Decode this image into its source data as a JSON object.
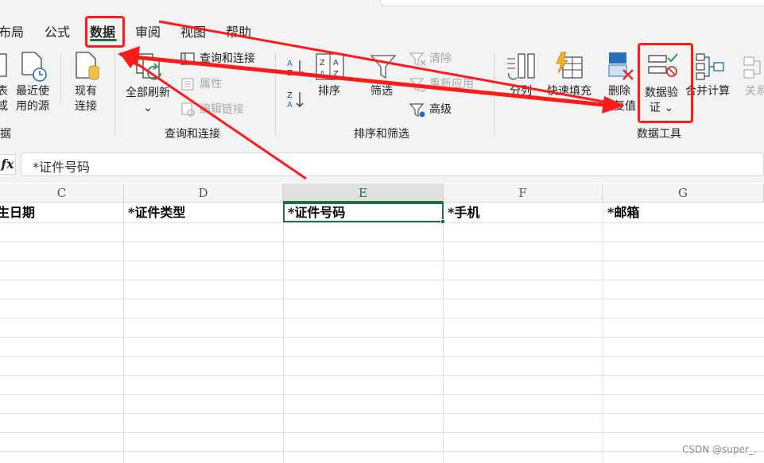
{
  "tabs": [
    "布局",
    "公式",
    "数据",
    "审阅",
    "视图",
    "帮助"
  ],
  "active_tab": "数据",
  "ribbon": {
    "get_data": {
      "partial_btn1_lines": [
        "表",
        "或"
      ],
      "recent_sources_lines": [
        "最近使",
        "用的源"
      ],
      "existing_conn_lines": [
        "现有",
        "连接"
      ],
      "group_label_partial": "据"
    },
    "queries": {
      "refresh_all": "全部刷新",
      "refresh_chevron": "⌄",
      "queries_connections": "查询和连接",
      "properties": "属性",
      "edit_links": "编辑链接",
      "group_label": "查询和连接"
    },
    "sort_filter": {
      "sort": "排序",
      "filter": "筛选",
      "clear": "清除",
      "reapply": "重新应用",
      "advanced": "高级",
      "group_label": "排序和筛选"
    },
    "data_tools": {
      "text_to_columns": "分列",
      "flash_fill": "快速填充",
      "remove_dup_lines": [
        "删除",
        "重复值"
      ],
      "data_validation_lines": [
        "数据验",
        "证 ⌄"
      ],
      "consolidate": "合并计算",
      "relationships_partial": "关系",
      "group_label": "数据工具"
    }
  },
  "formula_bar": {
    "fx": "fx",
    "value": "*证件号码"
  },
  "columns": [
    {
      "letter": "C",
      "header": "生日期",
      "selected": false
    },
    {
      "letter": "D",
      "header": "*证件类型",
      "selected": false
    },
    {
      "letter": "E",
      "header": "*证件号码",
      "selected": true
    },
    {
      "letter": "F",
      "header": "*手机",
      "selected": false
    },
    {
      "letter": "G",
      "header": "*邮箱",
      "selected": false
    }
  ],
  "colors": {
    "accent_green": "#1e7145",
    "annotation_red": "#ff1a1a",
    "ribbon_bg": "#f3f3f3"
  },
  "icons": [
    "table-icon",
    "clock-doc-icon",
    "db-doc-icon",
    "refresh-icon",
    "queries-icon",
    "properties-icon",
    "links-icon",
    "sort-asc-icon",
    "sort-desc-icon",
    "sort-icon",
    "filter-icon",
    "clear-filter-icon",
    "reapply-icon",
    "advanced-filter-icon",
    "text-to-columns-icon",
    "flash-fill-icon",
    "remove-duplicates-icon",
    "data-validation-icon",
    "consolidate-icon",
    "relationships-icon"
  ],
  "watermark": "CSDN @super_."
}
